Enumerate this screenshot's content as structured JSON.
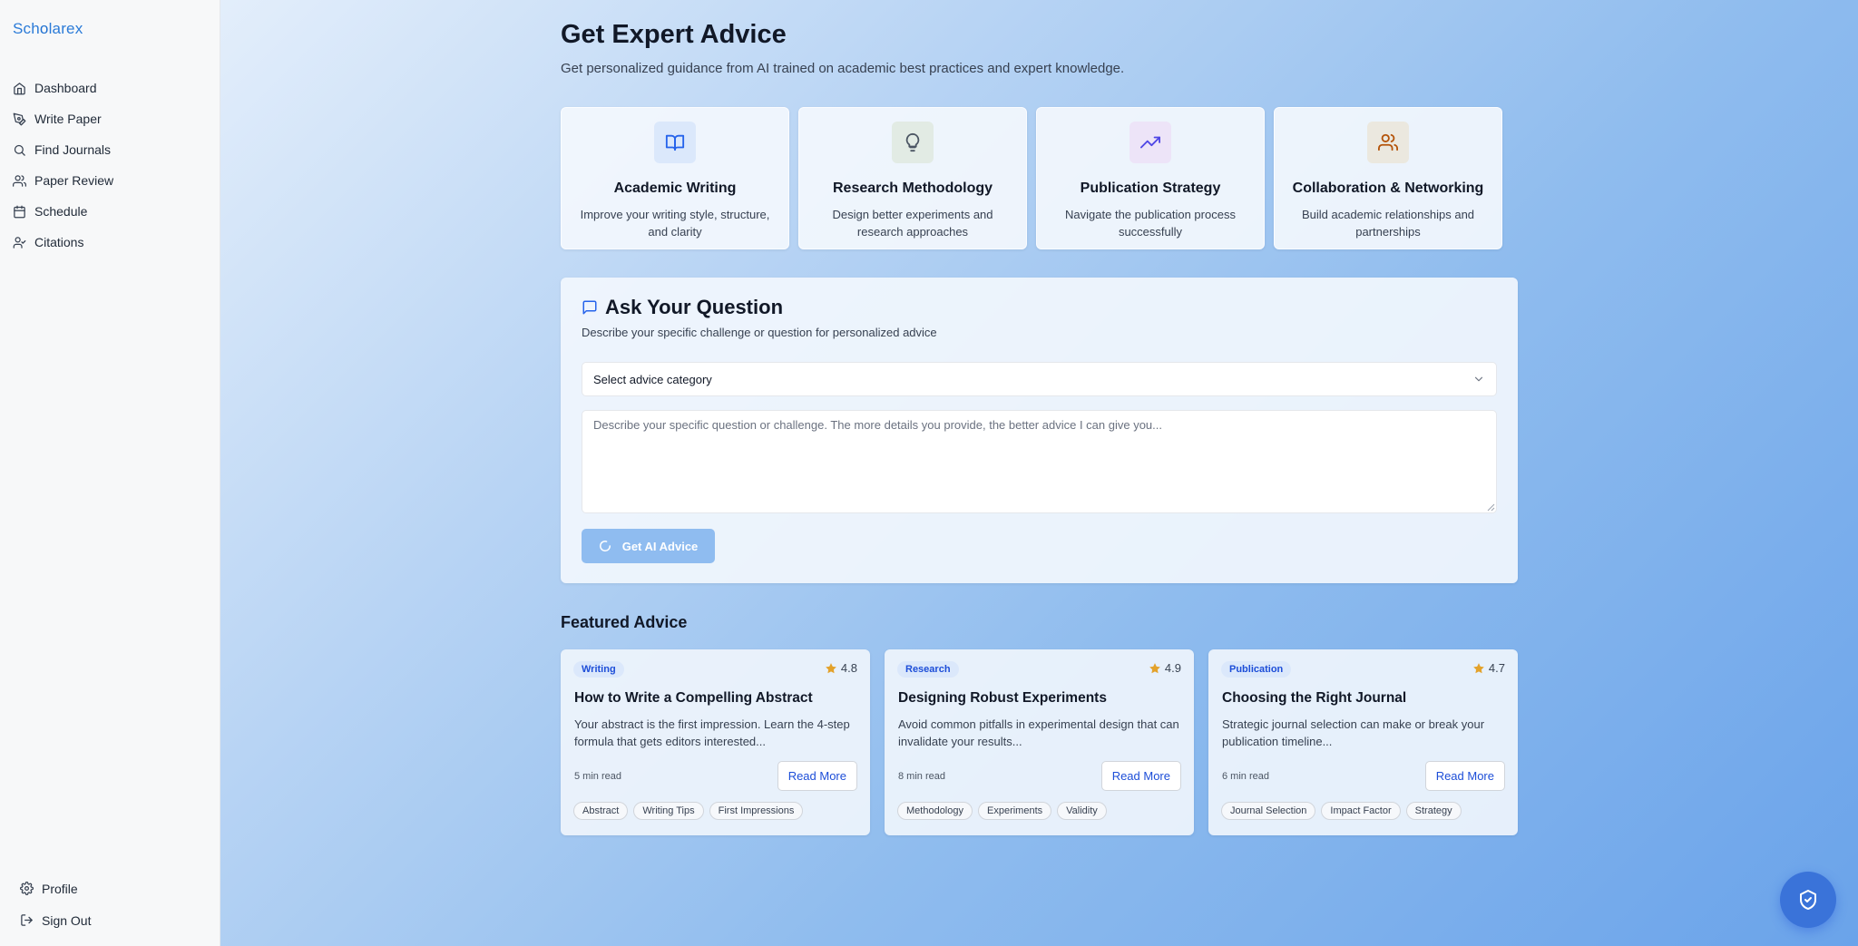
{
  "brand": {
    "logo_prefix": "Sch",
    "logo_dot": "o",
    "logo_suffix": "larex"
  },
  "sidebar": {
    "items": [
      {
        "label": "Dashboard",
        "icon": "home-icon"
      },
      {
        "label": "Write Paper",
        "icon": "pen-icon"
      },
      {
        "label": "Find Journals",
        "icon": "search-icon"
      },
      {
        "label": "Paper Review",
        "icon": "users-icon"
      },
      {
        "label": "Schedule",
        "icon": "calendar-icon"
      },
      {
        "label": "Citations",
        "icon": "user-check-icon"
      }
    ],
    "bottom": [
      {
        "label": "Profile",
        "icon": "gear-icon"
      },
      {
        "label": "Sign Out",
        "icon": "logout-icon"
      }
    ]
  },
  "page": {
    "title": "Get Expert Advice",
    "subtitle": "Get personalized guidance from AI trained on academic best practices and expert knowledge."
  },
  "categories": [
    {
      "title": "Academic Writing",
      "desc": "Improve your writing style, structure, and clarity",
      "icon": "book-open-icon",
      "color": "#2563eb",
      "bg": "#dbe8fb"
    },
    {
      "title": "Research Methodology",
      "desc": "Design better experiments and research approaches",
      "icon": "lightbulb-icon",
      "color": "#4b5563",
      "bg": "#e2ebe4"
    },
    {
      "title": "Publication Strategy",
      "desc": "Navigate the publication process successfully",
      "icon": "trending-up-icon",
      "color": "#4f46e5",
      "bg": "#ede4f8"
    },
    {
      "title": "Collaboration & Networking",
      "desc": "Build academic relationships and partnerships",
      "icon": "users-icon",
      "color": "#b45309",
      "bg": "#ebe8df"
    }
  ],
  "ask": {
    "title": "Ask Your Question",
    "desc": "Describe your specific challenge or question for personalized advice",
    "select_value": "Select advice category",
    "textarea_placeholder": "Describe your specific question or challenge. The more details you provide, the better advice I can give you...",
    "button_label": "Get AI Advice"
  },
  "featured": {
    "title": "Featured Advice",
    "read_more_label": "Read More",
    "items": [
      {
        "category": "Writing",
        "rating": "4.8",
        "title": "How to Write a Compelling Abstract",
        "desc": "Your abstract is the first impression. Learn the 4-step formula that gets editors interested...",
        "read_time": "5 min read",
        "tags": [
          "Abstract",
          "Writing Tips",
          "First Impressions"
        ]
      },
      {
        "category": "Research",
        "rating": "4.9",
        "title": "Designing Robust Experiments",
        "desc": "Avoid common pitfalls in experimental design that can invalidate your results...",
        "read_time": "8 min read",
        "tags": [
          "Methodology",
          "Experiments",
          "Validity"
        ]
      },
      {
        "category": "Publication",
        "rating": "4.7",
        "title": "Choosing the Right Journal",
        "desc": "Strategic journal selection can make or break your publication timeline...",
        "read_time": "6 min read",
        "tags": [
          "Journal Selection",
          "Impact Factor",
          "Strategy"
        ]
      }
    ]
  },
  "colors": {
    "accent": "#2563eb",
    "star": "#e3a22b",
    "fab": "#3a73d9",
    "button_disabled": "#8fbcf0"
  }
}
